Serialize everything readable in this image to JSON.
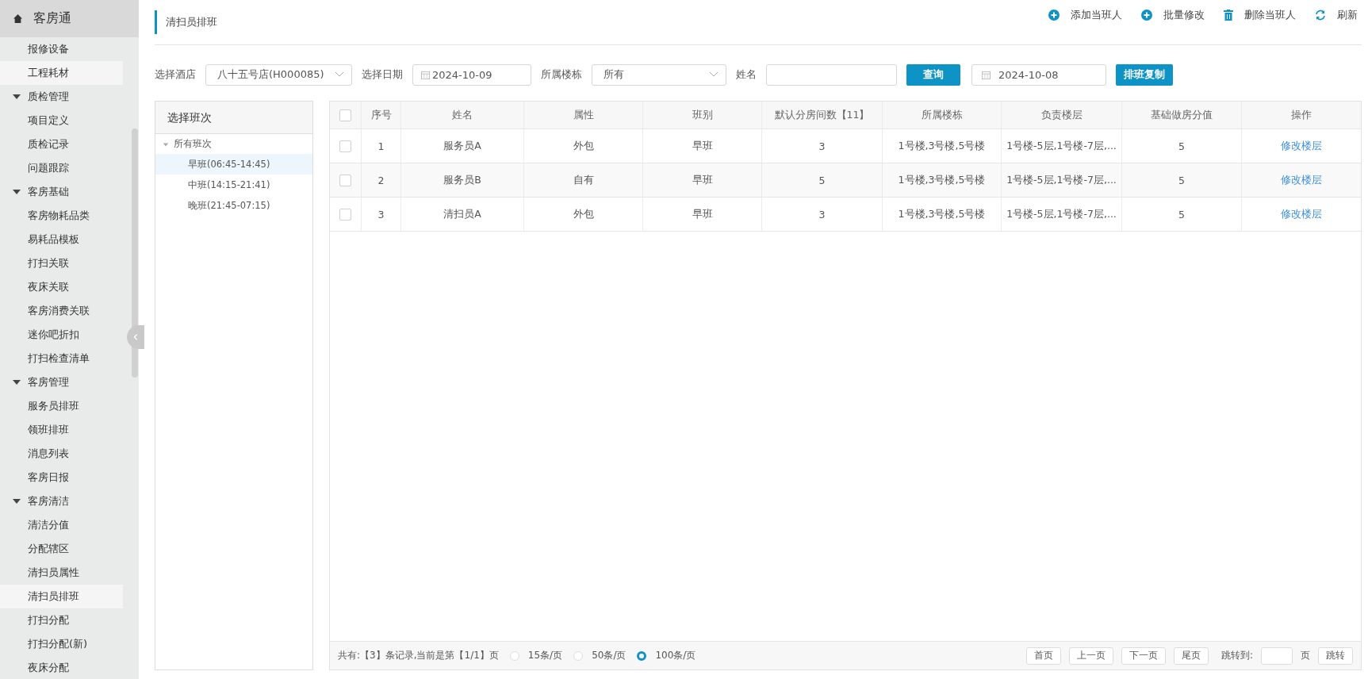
{
  "sidebar": {
    "title": "客房通",
    "items": [
      {
        "label": "报修设备",
        "selected": false
      },
      {
        "label": "工程耗材",
        "selected": true
      },
      {
        "label": "质检管理",
        "expanded": true,
        "children": [
          {
            "label": "项目定义",
            "selected": false
          },
          {
            "label": "质检记录",
            "selected": false
          },
          {
            "label": "问题跟踪",
            "selected": false
          }
        ]
      },
      {
        "label": "客房基础",
        "expanded": true,
        "children": [
          {
            "label": "客房物耗品类",
            "selected": false
          },
          {
            "label": "易耗品模板",
            "selected": false
          },
          {
            "label": "打扫关联",
            "selected": false
          },
          {
            "label": "夜床关联",
            "selected": false
          },
          {
            "label": "客房消费关联",
            "selected": false
          },
          {
            "label": "迷你吧折扣",
            "selected": false
          },
          {
            "label": "打扫检查清单",
            "selected": false
          }
        ]
      },
      {
        "label": "客房管理",
        "expanded": true,
        "children": [
          {
            "label": "服务员排班",
            "selected": false
          },
          {
            "label": "领班排班",
            "selected": false
          },
          {
            "label": "消息列表",
            "selected": false
          },
          {
            "label": "客房日报",
            "selected": false
          }
        ]
      },
      {
        "label": "客房清洁",
        "expanded": true,
        "children": [
          {
            "label": "清洁分值",
            "selected": false
          },
          {
            "label": "分配辖区",
            "selected": false
          },
          {
            "label": "清扫员属性",
            "selected": false
          },
          {
            "label": "清扫员排班",
            "selected": true
          },
          {
            "label": "打扫分配",
            "selected": false
          },
          {
            "label": "打扫分配(新)",
            "selected": false
          },
          {
            "label": "夜床分配",
            "selected": false
          }
        ]
      }
    ]
  },
  "page": {
    "title": "清扫员排班"
  },
  "toolbar": [
    {
      "kind": "add",
      "label": "添加当班人"
    },
    {
      "kind": "add",
      "label": "批量修改"
    },
    {
      "kind": "delete",
      "label": "删除当班人"
    },
    {
      "kind": "refresh",
      "label": "刷新"
    }
  ],
  "filters": {
    "hotel_label": "选择酒店",
    "hotel": "八十五号店(H000085)",
    "date_label": "选择日期",
    "date": "2024-10-09",
    "building_label": "所属楼栋",
    "building": "所有",
    "name_label": "姓名",
    "query_button": "查询",
    "copy_date": "2024-10-08",
    "copy_button": "排班复制"
  },
  "shift_panel": {
    "title": "选择班次",
    "root": {
      "label": "所有班次",
      "expanded": true,
      "children": [
        {
          "label": "早班(06:45-14:45)",
          "selected": true
        },
        {
          "label": "中班(14:15-21:41)",
          "selected": false
        },
        {
          "label": "晚班(21:45-07:15)",
          "selected": false
        }
      ]
    }
  },
  "table": {
    "header_checked": false,
    "columns": [
      "序号",
      "姓名",
      "属性",
      "班别",
      "默认分房间数【11】",
      "所属楼栋",
      "负责楼层",
      "基础做房分值",
      "操作"
    ],
    "rows": [
      {
        "checked": false,
        "cells": [
          "1",
          "服务员A",
          "外包",
          "早班",
          "3",
          "1号楼,3号楼,5号楼",
          "1号楼-5层,1号楼-7层,...",
          "5"
        ],
        "action": "修改楼层"
      },
      {
        "checked": false,
        "cells": [
          "2",
          "服务员B",
          "自有",
          "早班",
          "5",
          "1号楼,3号楼,5号楼",
          "1号楼-5层,1号楼-7层,...",
          "5"
        ],
        "action": "修改楼层"
      },
      {
        "checked": false,
        "cells": [
          "3",
          "清扫员A",
          "外包",
          "早班",
          "3",
          "1号楼,3号楼,5号楼",
          "1号楼-5层,1号楼-7层,...",
          "5"
        ],
        "action": "修改楼层"
      }
    ]
  },
  "footer": {
    "summary": "共有:【3】条记录,当前是第【1/1】页",
    "page_sizes": [
      {
        "label": "15条/页",
        "selected": false
      },
      {
        "label": "50条/页",
        "selected": false
      },
      {
        "label": "100条/页",
        "selected": true
      }
    ],
    "pager": [
      "首页",
      "上一页",
      "下一页",
      "尾页"
    ],
    "jump_label": "跳转到:",
    "jump_unit": "页",
    "jump_button": "跳转"
  }
}
